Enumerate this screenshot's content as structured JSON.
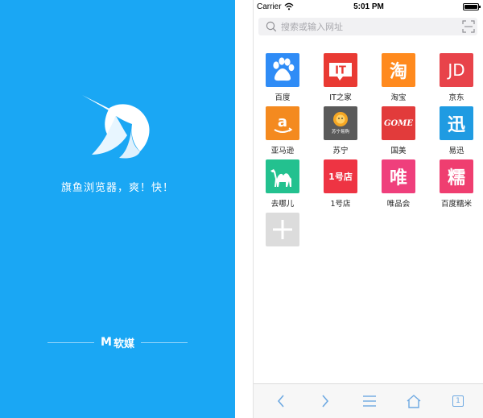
{
  "splash": {
    "slogan": "旗鱼浏览器，爽！快！",
    "brand": "软媒",
    "brand_letter": "M",
    "bg_color": "#1aa7f4"
  },
  "status_bar": {
    "carrier": "Carrier",
    "time": "5:01 PM"
  },
  "search": {
    "placeholder": "搜索或输入网址"
  },
  "apps": [
    {
      "label": "百度",
      "icon": "baidu-paw-icon",
      "color": "#2f8cf6"
    },
    {
      "label": "IT之家",
      "icon": "ithome-icon",
      "color": "#e93a33",
      "tile_text": "IT"
    },
    {
      "label": "淘宝",
      "icon": "taobao-icon",
      "color": "#ff8a1e",
      "tile_text": "淘"
    },
    {
      "label": "京东",
      "icon": "jd-icon",
      "color": "#e8434a",
      "tile_text": "JD"
    },
    {
      "label": "亚马逊",
      "icon": "amazon-icon",
      "color": "#f48a1f",
      "tile_text": "a"
    },
    {
      "label": "苏宁",
      "icon": "suning-lion-icon",
      "color": "#5a5a5a",
      "tile_text": "苏宁易购"
    },
    {
      "label": "国美",
      "icon": "gome-icon",
      "color": "#e23b3b",
      "tile_text": "GOME"
    },
    {
      "label": "易迅",
      "icon": "yixun-icon",
      "color": "#1f9be2",
      "tile_text": "迅"
    },
    {
      "label": "去哪儿",
      "icon": "qunar-camel-icon",
      "color": "#23c18f"
    },
    {
      "label": "1号店",
      "icon": "yhd-icon",
      "color": "#ee3443",
      "tile_text": "1号店"
    },
    {
      "label": "唯品会",
      "icon": "vip-icon",
      "color": "#ef3f7c",
      "tile_text": "唯"
    },
    {
      "label": "百度糯米",
      "icon": "nuomi-icon",
      "color": "#ef3e70",
      "tile_text": "糯"
    }
  ],
  "add_tile": {
    "icon": "plus-icon",
    "color": "#dcdcdc"
  },
  "toolbar": {
    "back_icon": "chevron-left-icon",
    "forward_icon": "chevron-right-icon",
    "menu_icon": "menu-icon",
    "home_icon": "home-icon",
    "tabs_count": "1",
    "accent": "#6ea9e2"
  }
}
